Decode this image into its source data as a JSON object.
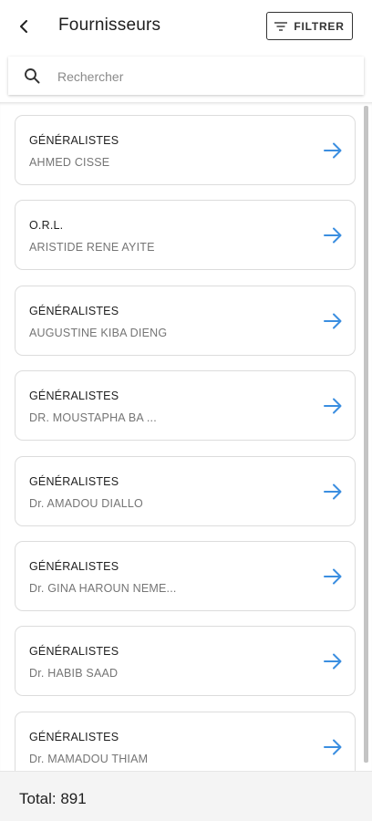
{
  "header": {
    "title": "Fournisseurs",
    "back_icon": "back-arrow-icon",
    "filter_label": "FILTRER",
    "filter_icon": "filter-lines-icon"
  },
  "search": {
    "placeholder": "Rechercher",
    "value": "",
    "icon": "search-icon"
  },
  "providers": [
    {
      "category": "GÉNÉRALISTES",
      "name": "AHMED CISSE"
    },
    {
      "category": "O.R.L.",
      "name": "ARISTIDE RENE AYITE"
    },
    {
      "category": "GÉNÉRALISTES",
      "name": "AUGUSTINE KIBA DIENG"
    },
    {
      "category": "GÉNÉRALISTES",
      "name": "DR. MOUSTAPHA BA ..."
    },
    {
      "category": "GÉNÉRALISTES",
      "name": "Dr. AMADOU DIALLO"
    },
    {
      "category": "GÉNÉRALISTES",
      "name": "Dr. GINA HAROUN NEME..."
    },
    {
      "category": "GÉNÉRALISTES",
      "name": "Dr. HABIB SAAD"
    },
    {
      "category": "GÉNÉRALISTES",
      "name": "Dr. MAMADOU THIAM"
    }
  ],
  "footer": {
    "total_text": "Total: 891"
  },
  "colors": {
    "accent_arrow": "#3b8ee0",
    "card_border": "#dcdcdc",
    "footer_bg": "#f4f4f4"
  }
}
